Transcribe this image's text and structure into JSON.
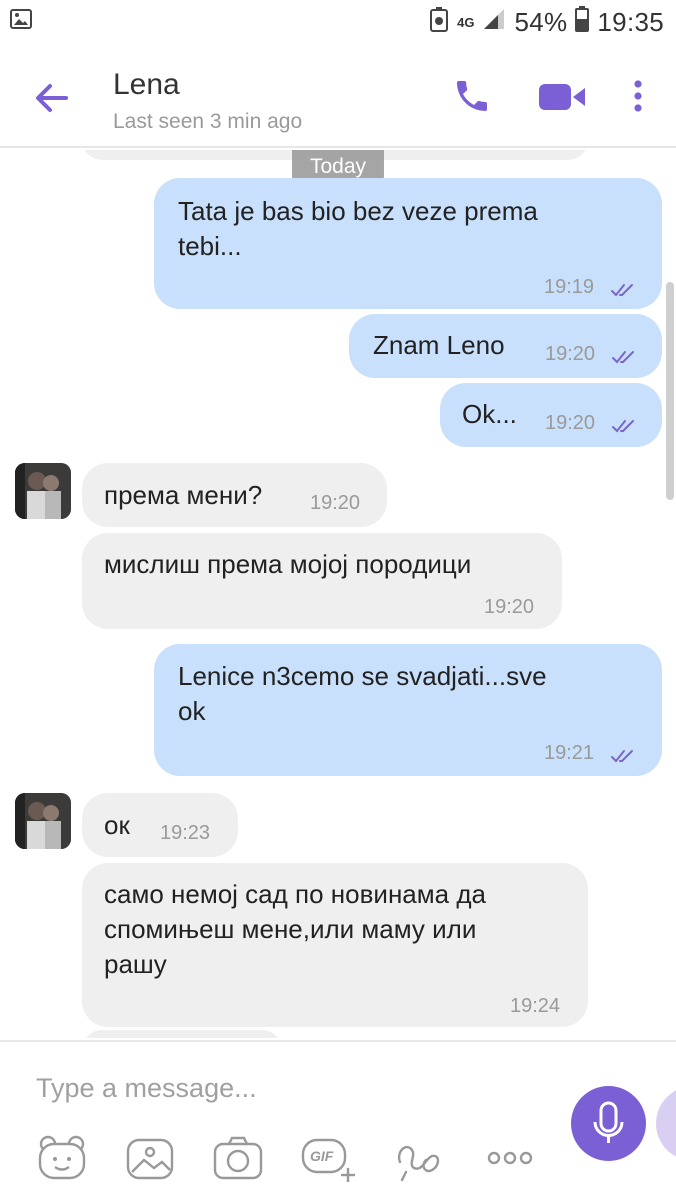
{
  "status_bar": {
    "network": "4G",
    "battery": "54%",
    "time": "19:35"
  },
  "header": {
    "contact_name": "Lena",
    "last_seen": "Last seen 3 min ago"
  },
  "chat": {
    "date_divider": "Today",
    "messages": [
      {
        "dir": "out",
        "text_lines": [
          "Tata je bas bio bez veze prema",
          "tebi..."
        ],
        "time": "19:19"
      },
      {
        "dir": "out",
        "text_lines": [
          "Znam Leno"
        ],
        "time": "19:20"
      },
      {
        "dir": "out",
        "text_lines": [
          "Ok..."
        ],
        "time": "19:20"
      },
      {
        "dir": "in",
        "text_lines": [
          "према мени?"
        ],
        "time": "19:20"
      },
      {
        "dir": "in",
        "text_lines": [
          "мислиш према мојој породици"
        ],
        "time": "19:20"
      },
      {
        "dir": "out",
        "text_lines": [
          "Lenice n3cemo se svadjati...sve",
          "ok"
        ],
        "time": "19:21"
      },
      {
        "dir": "in",
        "text_lines": [
          "ок"
        ],
        "time": "19:23"
      },
      {
        "dir": "in",
        "text_lines": [
          "само немој сад по новинама да",
          "спомињеш мене,или маму или",
          "рашу"
        ],
        "time": "19:24"
      }
    ]
  },
  "composer": {
    "placeholder": "Type a message...",
    "tools": [
      "sticker-icon",
      "gallery-icon",
      "camera-icon",
      "gif-icon",
      "doodle-icon",
      "more-options-icon"
    ],
    "gif_label": "GIF"
  },
  "colors": {
    "accent": "#7a5fd5",
    "outgoing_bubble": "#c8e0fb",
    "incoming_bubble": "#efefef",
    "read_ticks": "#7a66c7"
  }
}
